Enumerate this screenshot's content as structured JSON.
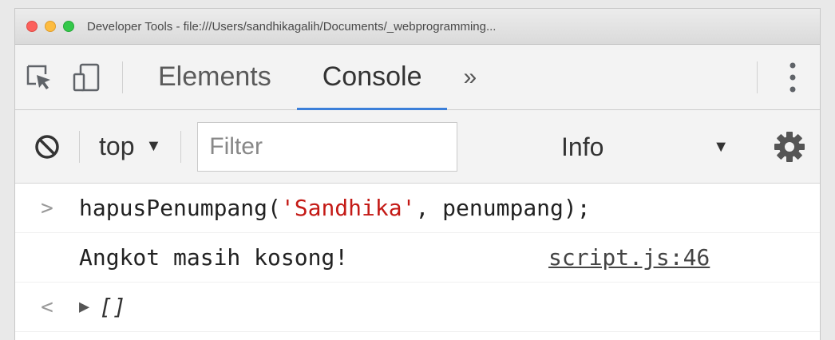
{
  "window": {
    "title": "Developer Tools - file:///Users/sandhikagalih/Documents/_webprogramming..."
  },
  "tabs": [
    {
      "label": "Elements",
      "active": false
    },
    {
      "label": "Console",
      "active": true
    }
  ],
  "more_tabs_glyph": "»",
  "toolbar": {
    "context_label": "top",
    "filter_placeholder": "Filter",
    "levels_label": "Info"
  },
  "console": {
    "input": {
      "prompt": ">",
      "fn_call": "hapusPenumpang(",
      "string_arg": "'Sandhika'",
      "rest": ", penumpang);"
    },
    "log": {
      "message": "Angkot masih kosong!",
      "source": "script.js:46"
    },
    "result": {
      "prompt": "<",
      "value": "[]"
    }
  },
  "colors": {
    "accent": "#3b7fd9",
    "string": "#c41a16",
    "red_light": "#fc605c",
    "yellow_light": "#fdbc40",
    "green_light": "#34c84a"
  },
  "icons": [
    "inspect-element-icon",
    "device-toggle-icon",
    "more-tabs-icon",
    "kebab-menu-icon",
    "clear-console-icon",
    "settings-gear-icon"
  ]
}
